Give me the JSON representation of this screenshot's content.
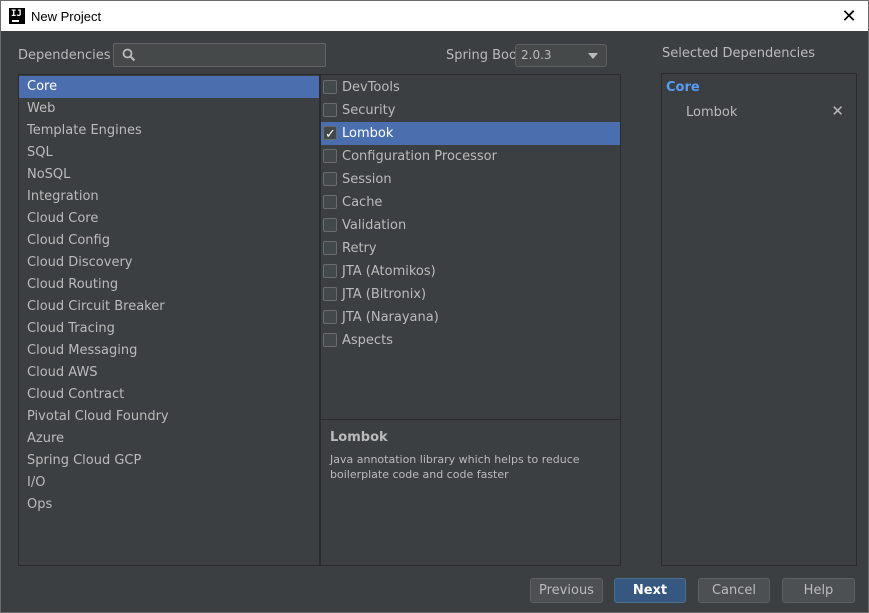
{
  "window": {
    "title": "New Project",
    "app_icon_text": "IJ"
  },
  "header": {
    "dependencies_label": "Dependencies",
    "search": {
      "value": "",
      "placeholder": ""
    },
    "spring_boot_label": "Spring Boot",
    "spring_boot_version": "2.0.3",
    "selected_heading": "Selected Dependencies"
  },
  "categories": [
    "Core",
    "Web",
    "Template Engines",
    "SQL",
    "NoSQL",
    "Integration",
    "Cloud Core",
    "Cloud Config",
    "Cloud Discovery",
    "Cloud Routing",
    "Cloud Circuit Breaker",
    "Cloud Tracing",
    "Cloud Messaging",
    "Cloud AWS",
    "Cloud Contract",
    "Pivotal Cloud Foundry",
    "Azure",
    "Spring Cloud GCP",
    "I/O",
    "Ops"
  ],
  "selected_category": "Core",
  "dependencies": [
    {
      "label": "DevTools",
      "checked": false
    },
    {
      "label": "Security",
      "checked": false
    },
    {
      "label": "Lombok",
      "checked": true
    },
    {
      "label": "Configuration Processor",
      "checked": false
    },
    {
      "label": "Session",
      "checked": false
    },
    {
      "label": "Cache",
      "checked": false
    },
    {
      "label": "Validation",
      "checked": false
    },
    {
      "label": "Retry",
      "checked": false
    },
    {
      "label": "JTA (Atomikos)",
      "checked": false
    },
    {
      "label": "JTA (Bitronix)",
      "checked": false
    },
    {
      "label": "JTA (Narayana)",
      "checked": false
    },
    {
      "label": "Aspects",
      "checked": false
    }
  ],
  "highlighted_dependency": "Lombok",
  "description": {
    "title": "Lombok",
    "text": "Java annotation library which helps to reduce boilerplate code and code faster"
  },
  "selected": {
    "category": "Core",
    "items": [
      "Lombok"
    ]
  },
  "buttons": {
    "previous": "Previous",
    "next": "Next",
    "cancel": "Cancel",
    "help": "Help"
  },
  "colors": {
    "selection": "#4b6eaf",
    "link_blue": "#589df6",
    "background": "#3c3f41",
    "default_button": "#365880"
  }
}
